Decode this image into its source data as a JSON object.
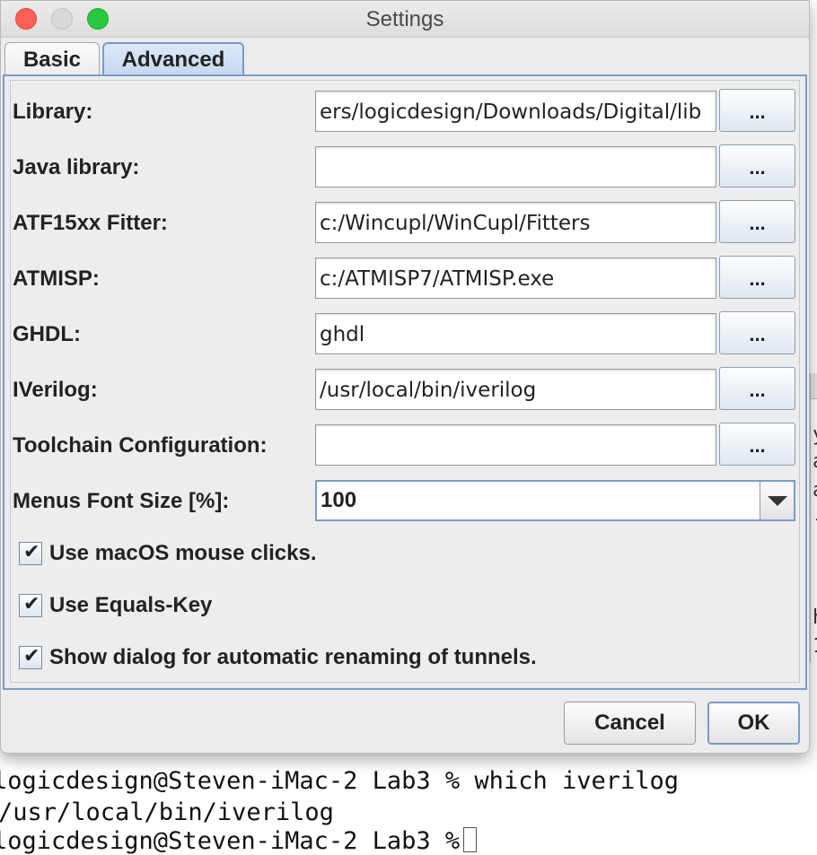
{
  "window": {
    "title": "Settings"
  },
  "tabs": [
    {
      "label": "Basic"
    },
    {
      "label": "Advanced"
    }
  ],
  "fields": {
    "library": {
      "label": "Library:",
      "value": "ers/logicdesign/Downloads/Digital/lib"
    },
    "java_library": {
      "label": "Java library:",
      "value": ""
    },
    "atf15xx_fitter": {
      "label": "ATF15xx Fitter:",
      "value": "c:/Wincupl/WinCupl/Fitters"
    },
    "atmisp": {
      "label": "ATMISP:",
      "value": "c:/ATMISP7/ATMISP.exe"
    },
    "ghdl": {
      "label": "GHDL:",
      "value": "ghdl"
    },
    "iverilog": {
      "label": "IVerilog:",
      "value": "/usr/local/bin/iverilog"
    },
    "toolchain": {
      "label": "Toolchain Configuration:",
      "value": ""
    },
    "browse_label": "..."
  },
  "menus_font_size": {
    "label": "Menus Font Size [%]:",
    "value": "100"
  },
  "checkboxes": [
    {
      "label": "Use macOS mouse clicks.",
      "checked": true,
      "mark": "✔"
    },
    {
      "label": "Use Equals-Key",
      "checked": true,
      "mark": "✔"
    },
    {
      "label": "Show dialog for automatic renaming of tunnels.",
      "checked": true,
      "mark": "✔"
    }
  ],
  "buttons": {
    "cancel": "Cancel",
    "ok": "OK"
  },
  "terminal": {
    "line1": "logicdesign@Steven-iMac-2 Lab3 % which iverilog",
    "line2": "/usr/local/bin/iverilog",
    "line3": "logicdesign@Steven-iMac-2 Lab3 %"
  },
  "background_window": {
    "fragments": [
      "y",
      "a",
      "a",
      "-",
      "h",
      "1"
    ]
  },
  "colors": {
    "accent": "#7a9cc8",
    "close": "#fe5f57",
    "maximize": "#28c840"
  }
}
